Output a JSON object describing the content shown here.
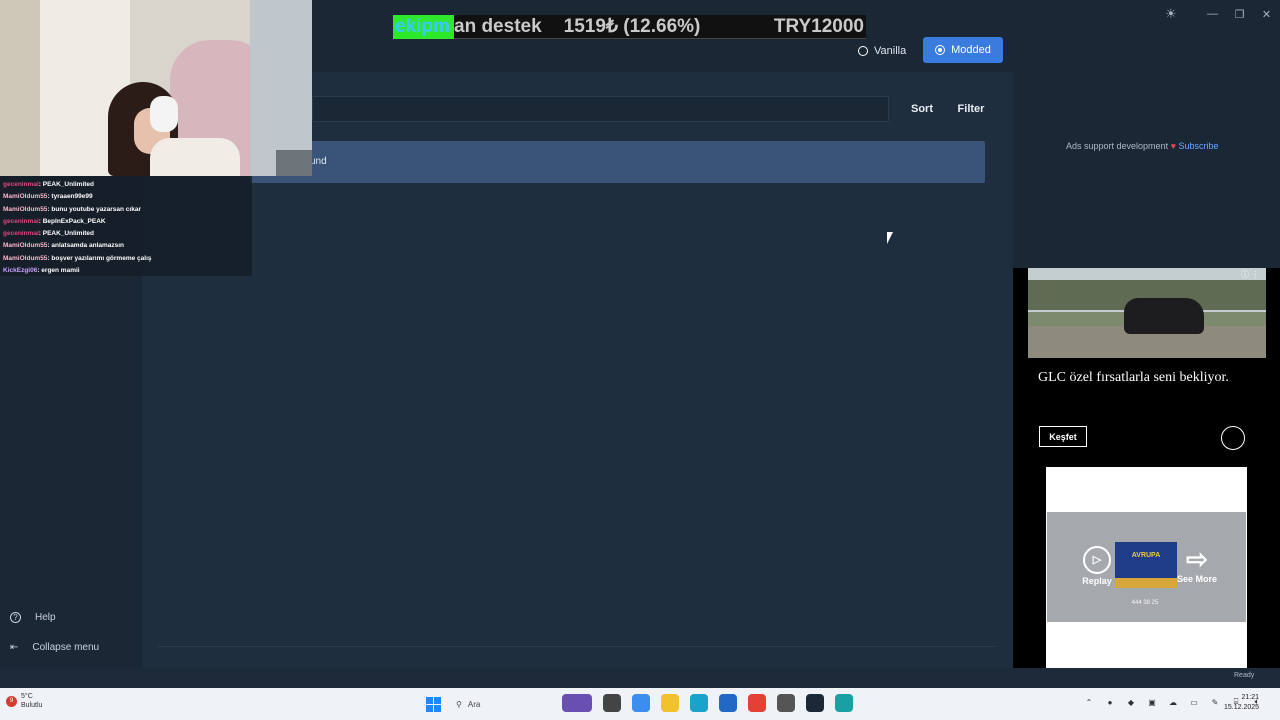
{
  "ticker": {
    "highlight": "ekipm",
    "rest": "an destek",
    "change": "1519₺ (12.66%)",
    "price": "TRY12000",
    "highlight_color": "#2ee82e"
  },
  "mode_toggle": {
    "vanilla_label": "Vanilla",
    "modded_label": "Modded",
    "active": "Modded",
    "accent": "#3a7be0"
  },
  "toolbar": {
    "sort_label": "Sort",
    "filter_label": "Filter"
  },
  "notice": {
    "text": "und"
  },
  "chat": [
    {
      "user": "geceninmai",
      "msg": ": PEAK_Unlimited",
      "color": "#e0457b"
    },
    {
      "user": "MamiOldum55",
      "msg": ": tyraaen99e99",
      "color": "#ffb6c8"
    },
    {
      "user": "MamiOldum55",
      "msg": ": bunu youtube yazarsan cıkar",
      "color": "#ffb6c8"
    },
    {
      "user": "geceninmai",
      "msg": ": BepInExPack_PEAK",
      "color": "#e0457b"
    },
    {
      "user": "geceninmai",
      "msg": ": PEAK_Unlimited",
      "color": "#e0457b"
    },
    {
      "user": "MamiOldum55",
      "msg": ": anlatsamda anlamazsın",
      "color": "#ffb6c8"
    },
    {
      "user": "MamiOldum55",
      "msg": ": boşver yazılarımı görmeme çalış",
      "color": "#ffb6c8"
    },
    {
      "user": "KickEzgi06",
      "msg": ": ergen mamii",
      "color": "#c9a0ff"
    }
  ],
  "sidebar": {
    "help_label": "Help",
    "collapse_label": "Collapse menu"
  },
  "ads": {
    "note": "Ads support development",
    "subscribe": "Subscribe",
    "headline": "GLC özel fırsatlarla seni bekliyor.",
    "cta": "Keşfet",
    "logo_text": "AVRUPA",
    "replay_label": "Replay",
    "see_more_label": "See More",
    "phone": "444 38 25"
  },
  "status": "Ready",
  "taskbar": {
    "weather_temp": "5°C",
    "weather_desc": "Bulutlu",
    "search_placeholder": "Ara",
    "time": "21:21",
    "date": "15.12.2025"
  },
  "icons": [
    "play-circle-icon",
    "sun-icon",
    "help-icon",
    "collapse-icon",
    "search-icon",
    "windows-start-icon",
    "heart-icon",
    "mercedes-logo-icon",
    "replay-icon",
    "arrow-right-icon"
  ]
}
